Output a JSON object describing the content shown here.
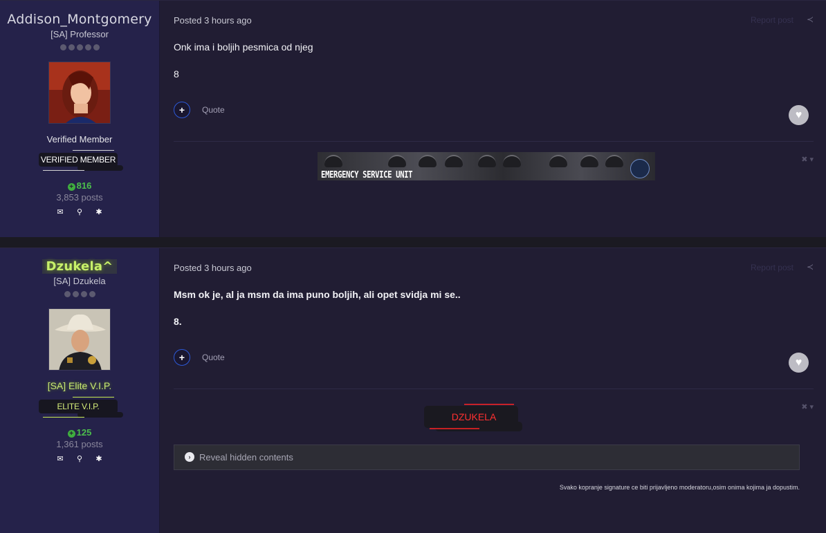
{
  "posts": [
    {
      "author": {
        "name": "Addison_Montgomery",
        "title": "[SA] Professor",
        "pips": 5,
        "group": "Verified Member",
        "badge": "VERIFIED MEMBER",
        "reputation": "816",
        "post_count": "3,853 posts"
      },
      "posted": "Posted 3 hours ago",
      "report": "Report post",
      "body": "Onk ima i boljih pesmica od njeg",
      "rating": "8",
      "quote_label": "Quote",
      "signature": {
        "banner_text": "EMERGENCY SERVICE UNIT"
      }
    },
    {
      "author": {
        "name": "Dzukela^",
        "title": "[SA] Dzukela",
        "pips": 4,
        "group": "[SA] Elite V.I.P.",
        "badge": "ELITE V.I.P.",
        "reputation": "125",
        "post_count": "1,361 posts"
      },
      "posted": "Posted 3 hours ago",
      "report": "Report post",
      "body": "Msm ok je, al ja msm da ima puno boljih, ali opet svidja mi se..",
      "rating": "8.",
      "quote_label": "Quote",
      "signature": {
        "badge_text": "DZUKELA",
        "reveal_label": "Reveal hidden contents",
        "note": "Svako kopranje signature ce biti prijavljeno moderatoru,osim onima kojima ja dopustim."
      }
    }
  ],
  "colors": {
    "accent_blue": "#2d5ad8",
    "rep_green": "#4cbf4c",
    "elite_green": "#c7f06a",
    "dzukela_red": "#ff2a2a"
  },
  "icons": [
    "envelope-icon",
    "search-icon",
    "gear-icon",
    "plus-icon",
    "heart-icon",
    "share-icon",
    "close-icon",
    "chevron-right-icon"
  ]
}
